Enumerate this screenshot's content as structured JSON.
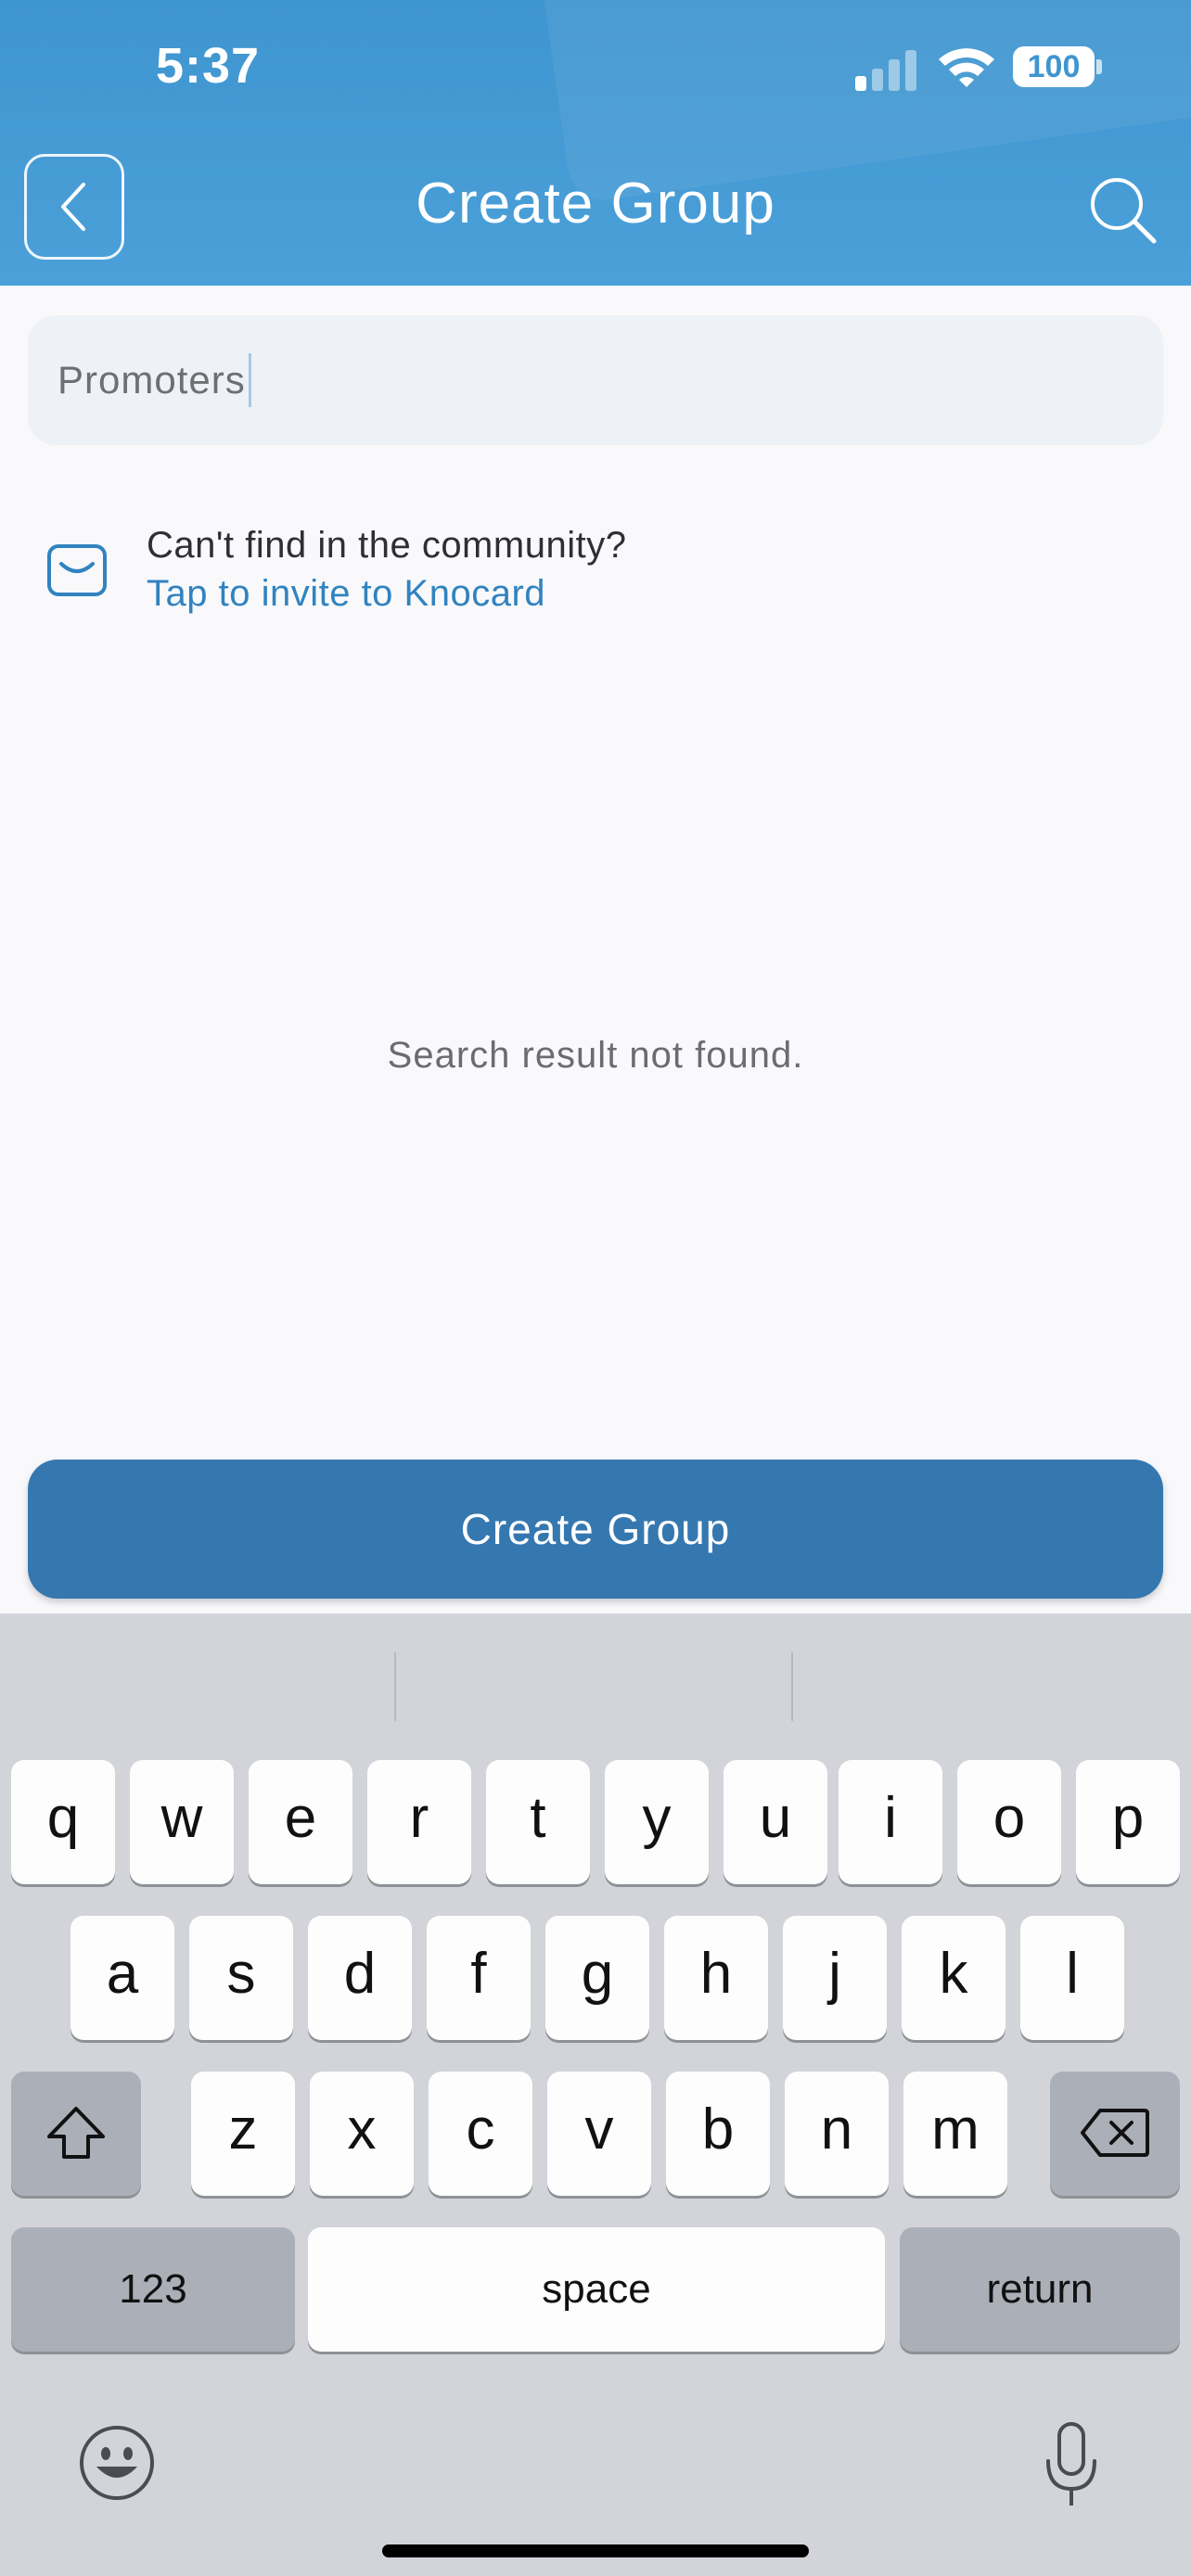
{
  "status_bar": {
    "time": "5:37",
    "battery": "100"
  },
  "header": {
    "title": "Create Group"
  },
  "search": {
    "value": "Promoters"
  },
  "invite": {
    "heading": "Can't find in the community?",
    "link": "Tap to invite to Knocard"
  },
  "empty_state": "Search result not found.",
  "create_button": "Create Group",
  "keyboard": {
    "row1": [
      "q",
      "w",
      "e",
      "r",
      "t",
      "y",
      "u",
      "i",
      "o",
      "p"
    ],
    "row2": [
      "a",
      "s",
      "d",
      "f",
      "g",
      "h",
      "j",
      "k",
      "l"
    ],
    "row3": [
      "z",
      "x",
      "c",
      "v",
      "b",
      "n",
      "m"
    ],
    "numbers_key": "123",
    "space_key": "space",
    "return_key": "return"
  },
  "colors": {
    "header": "#4299d4",
    "accent": "#3578b0",
    "link": "#3183c0"
  }
}
